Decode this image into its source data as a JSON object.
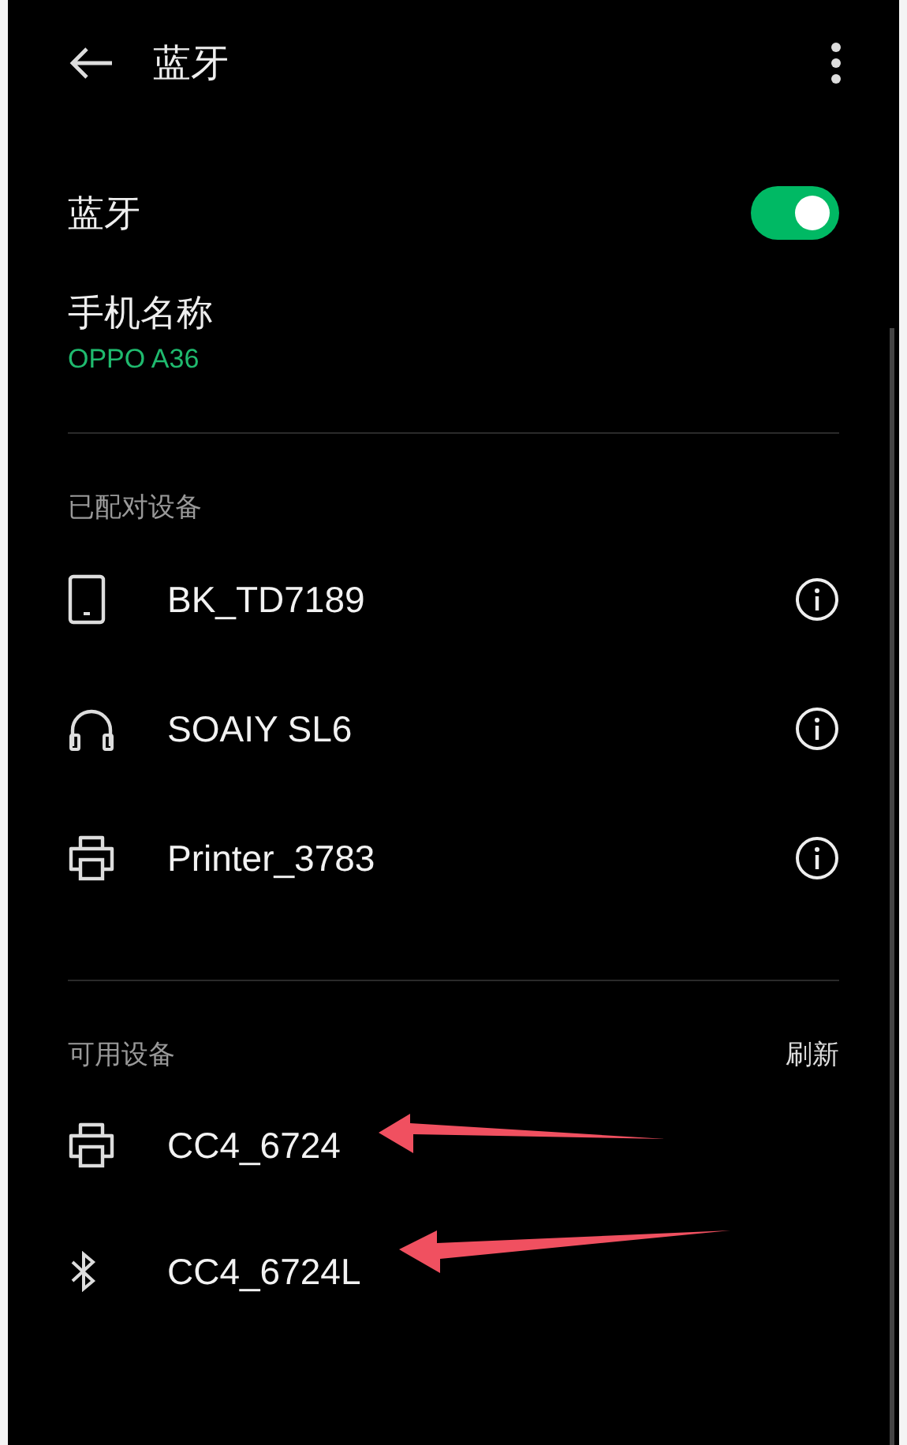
{
  "header": {
    "title": "蓝牙"
  },
  "bluetooth": {
    "label": "蓝牙",
    "on": true
  },
  "phone_name": {
    "label": "手机名称",
    "value": "OPPO A36"
  },
  "paired": {
    "heading": "已配对设备",
    "devices": [
      {
        "kind": "tablet",
        "name": "BK_TD7189",
        "info": true,
        "arrow": false
      },
      {
        "kind": "headphones",
        "name": "SOAIY SL6",
        "info": true,
        "arrow": false
      },
      {
        "kind": "printer",
        "name": "Printer_3783",
        "info": true,
        "arrow": false
      }
    ]
  },
  "available": {
    "heading": "可用设备",
    "action": "刷新",
    "devices": [
      {
        "kind": "printer",
        "name": "CC4_6724",
        "info": false,
        "arrow": true
      },
      {
        "kind": "bluetooth",
        "name": "CC4_6724L",
        "info": false,
        "arrow": true
      }
    ]
  }
}
